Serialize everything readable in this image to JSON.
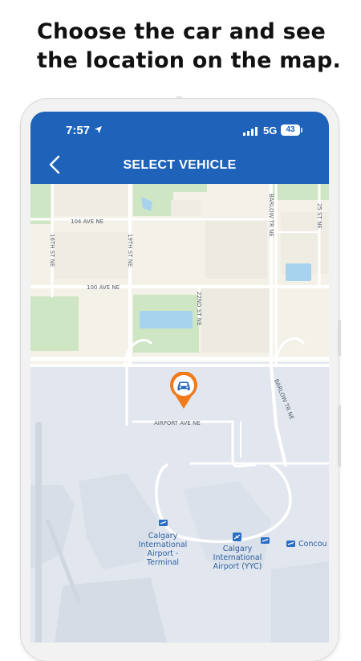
{
  "headline": {
    "line1": "Choose the car and see",
    "line2": "the location on the map."
  },
  "status_bar": {
    "time": "7:57",
    "network": "5G",
    "battery": "43"
  },
  "header": {
    "title": "SELECT VEHICLE",
    "back_icon": "chevron-left-icon"
  },
  "map": {
    "roads": {
      "ave_104": "104 AVE NE",
      "ave_100": "100 AVE NE",
      "st_16": "16TH ST NE",
      "st_19": "19TH ST NE",
      "st_22": "22ND ST NE",
      "st_25": "25 ST NE",
      "barlow_top": "BARLOW TR NE",
      "barlow_bottom": "BARLOW TR NE",
      "airport_ave": "AIRPORT AVE NE"
    },
    "places": {
      "terminal": [
        "Calgary",
        "International",
        "Airport -",
        "Terminal"
      ],
      "yyc": [
        "Calgary",
        "International",
        "Airport (YYC)"
      ],
      "concourse": "Concou"
    },
    "vehicle_marker_icon": "car-icon",
    "colors": {
      "land": "#f4f1e8",
      "park": "#cfe6c4",
      "water": "#a8d3ef",
      "airport": "#e2e7ef",
      "marker": "#f07b1d",
      "header": "#1e63b9"
    }
  }
}
